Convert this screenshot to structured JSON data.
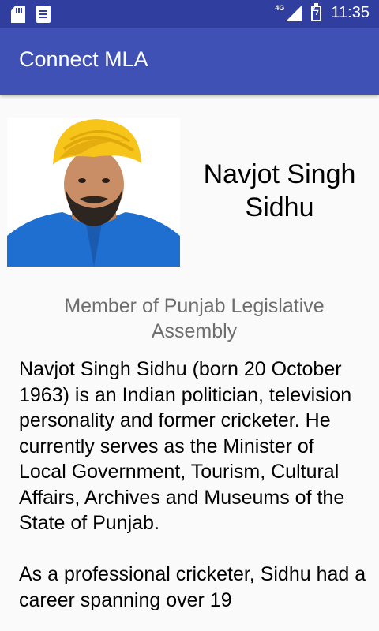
{
  "status_bar": {
    "network": "4G",
    "time": "11:35"
  },
  "app_bar": {
    "title": "Connect MLA"
  },
  "profile": {
    "name": "Navjot Singh Sidhu",
    "subtitle": "Member of Punjab Legislative Assembly",
    "bio": "Navjot Singh Sidhu (born 20 October 1963) is an Indian politician, television personality and former cricketer. He currently serves as the Minister of Local Government, Tourism, Cultural Affairs, Archives and Museums of the State of Punjab.\n\nAs a professional cricketer, Sidhu had a career spanning over 19"
  },
  "colors": {
    "status_bar": "#303f9f",
    "app_bar": "#3f51b5",
    "turban": "#f7c51a",
    "shirt": "#1f6fd1"
  }
}
